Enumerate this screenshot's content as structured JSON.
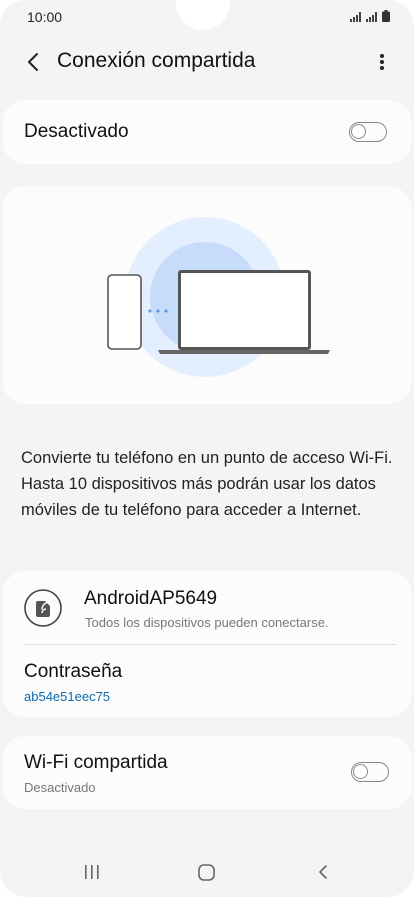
{
  "status": {
    "time": "10:00"
  },
  "header": {
    "title": "Conexión compartida"
  },
  "main_toggle": {
    "label": "Desactivado",
    "checked": false
  },
  "description": "Convierte tu teléfono en un punto de acceso Wi-Fi. Hasta 10 dispositivos más podrán usar los datos móviles de tu teléfono para acceder a Internet.",
  "network": {
    "name": "AndroidAP5649",
    "subtitle": "Todos los dispositivos pueden conectarse.",
    "password_label": "Contraseña",
    "password_value": "ab54e51eec75"
  },
  "wifi_shared": {
    "label": "Wi-Fi compartida",
    "status": "Desactivado",
    "checked": false
  },
  "colors": {
    "accent": "#0d6cad",
    "background": "#f4f4f4",
    "card": "#fcfcfc",
    "illustration_outer": "#e3efff",
    "illustration_inner": "#c7dcfb"
  }
}
